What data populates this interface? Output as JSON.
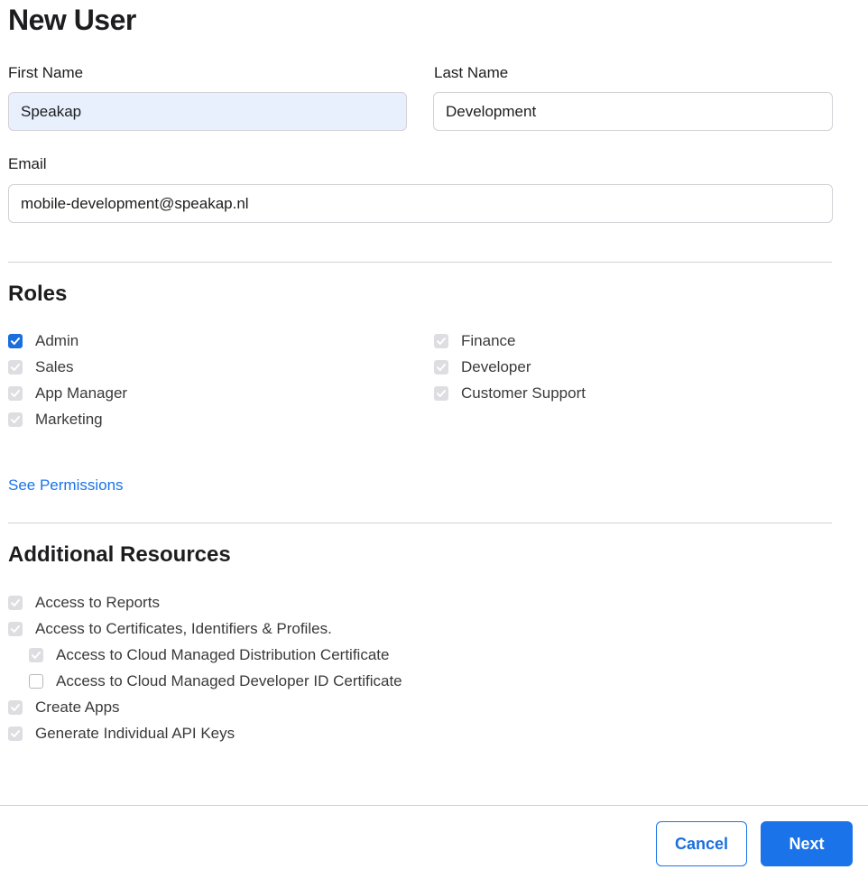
{
  "page": {
    "title": "New User"
  },
  "form": {
    "first_name": {
      "label": "First Name",
      "value": "Speakap"
    },
    "last_name": {
      "label": "Last Name",
      "value": "Development"
    },
    "email": {
      "label": "Email",
      "value": "mobile-development@speakap.nl"
    }
  },
  "roles": {
    "title": "Roles",
    "left": [
      {
        "label": "Admin",
        "checked": true,
        "enabled": true
      },
      {
        "label": "Sales",
        "checked": true,
        "enabled": false
      },
      {
        "label": "App Manager",
        "checked": true,
        "enabled": false
      },
      {
        "label": "Marketing",
        "checked": true,
        "enabled": false
      }
    ],
    "right": [
      {
        "label": "Finance",
        "checked": true,
        "enabled": false
      },
      {
        "label": "Developer",
        "checked": true,
        "enabled": false
      },
      {
        "label": "Customer Support",
        "checked": true,
        "enabled": false
      }
    ],
    "see_permissions": "See Permissions"
  },
  "resources": {
    "title": "Additional Resources",
    "items": [
      {
        "label": "Access to Reports",
        "checked": true,
        "enabled": false,
        "indent": false
      },
      {
        "label": "Access to Certificates, Identifiers & Profiles.",
        "checked": true,
        "enabled": false,
        "indent": false
      },
      {
        "label": "Access to Cloud Managed Distribution Certificate",
        "checked": true,
        "enabled": false,
        "indent": true
      },
      {
        "label": "Access to Cloud Managed Developer ID Certificate",
        "checked": false,
        "enabled": true,
        "indent": true
      },
      {
        "label": "Create Apps",
        "checked": true,
        "enabled": false,
        "indent": false
      },
      {
        "label": "Generate Individual API Keys",
        "checked": true,
        "enabled": false,
        "indent": false
      }
    ]
  },
  "footer": {
    "cancel_label": "Cancel",
    "next_label": "Next"
  },
  "colors": {
    "accent": "#1a73e8",
    "checked_disabled": "#dedee2",
    "autofill": "#e8f0fe"
  }
}
